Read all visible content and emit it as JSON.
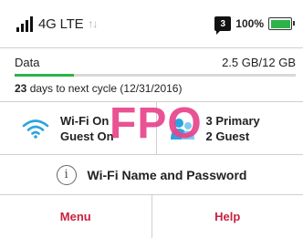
{
  "status": {
    "network": "4G LTE",
    "arrows": "↑↓",
    "message_count": "3",
    "battery_pct": "100%",
    "battery_level": 1.0,
    "signal_bars": 4
  },
  "usage": {
    "label": "Data",
    "amount": "2.5 GB/12 GB",
    "fraction_used": 0.21,
    "days": "23",
    "cycle_text": " days to next cycle (12/31/2016)"
  },
  "tiles": {
    "wifi": {
      "line1": "Wi-Fi On",
      "line2": "Guest On",
      "icon": "wifi-icon"
    },
    "devices": {
      "line1": "3 Primary",
      "line2": "2 Guest",
      "icon": "devices-icon"
    }
  },
  "overlay": {
    "fpo": "FPO"
  },
  "wifi_info": {
    "label": "Wi-Fi Name and Password",
    "icon": "info-icon"
  },
  "bottom": {
    "menu": "Menu",
    "help": "Help"
  },
  "colors": {
    "accent": "#c8223f",
    "wifi_blue": "#2ba4e0",
    "green": "#2db34a",
    "fpo_pink": "#e8448c"
  }
}
